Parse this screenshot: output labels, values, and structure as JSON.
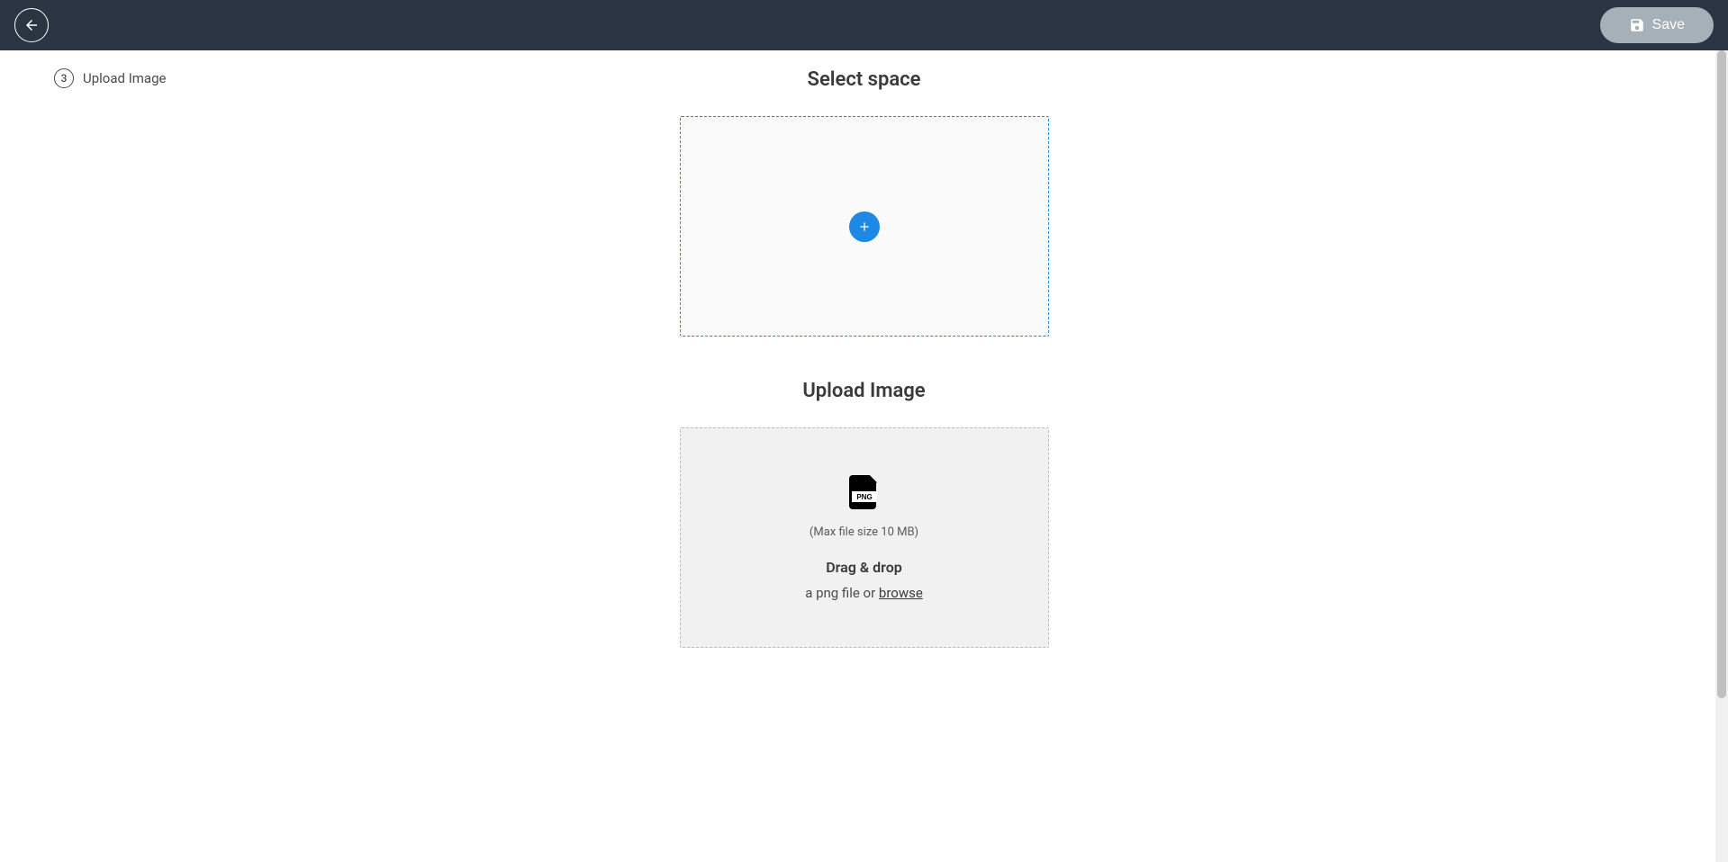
{
  "header": {
    "save_label": "Save"
  },
  "sidebar": {
    "steps": [
      {
        "number": "3",
        "label": "Upload Image"
      }
    ]
  },
  "main": {
    "select_space": {
      "title": "Select space"
    },
    "upload_image": {
      "title": "Upload Image",
      "icon_label": "PNG",
      "max_size_text": "(Max file size 10 MB)",
      "drag_drop_text": "Drag & drop",
      "file_type_text": "a png file or ",
      "browse_text": "browse"
    }
  }
}
